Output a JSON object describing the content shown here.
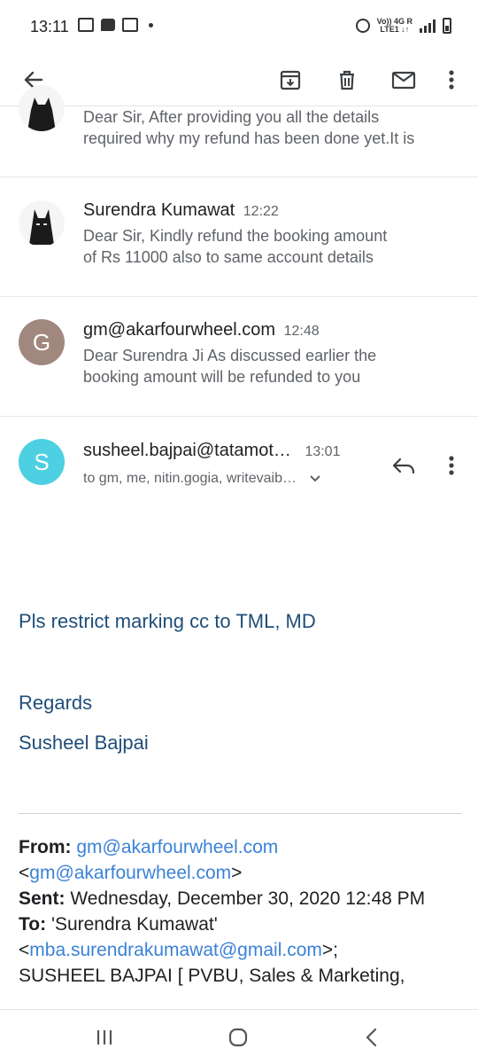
{
  "status_bar": {
    "time": "13:11",
    "network_top": "Vo)) 4G R",
    "network_bottom": "LTE1 ↓↑"
  },
  "toolbar": {
    "icons": [
      "back-arrow-icon",
      "archive-icon",
      "delete-icon",
      "mark-unread-icon",
      "more-vert-icon"
    ]
  },
  "thread": {
    "messages": [
      {
        "sender": "",
        "time": "",
        "snippet_line1": "Dear Sir, After providing you all the details",
        "snippet_line2": "required why my refund has been done yet.It is"
      },
      {
        "sender": "Surendra Kumawat",
        "time": "12:22",
        "snippet_line1": "Dear Sir, Kindly refund the booking amount",
        "snippet_line2": "of Rs 11000 also to same account details"
      },
      {
        "sender": "gm@akarfourwheel.com",
        "time": "12:48",
        "avatar_letter": "G",
        "avatar_color": "#a1887f",
        "snippet_line1": "Dear Surendra Ji As discussed earlier the",
        "snippet_line2": "booking amount will be refunded to you"
      }
    ],
    "expanded": {
      "sender": "susheel.bajpai@tatamot…",
      "time": "13:01",
      "avatar_letter": "S",
      "avatar_color": "#4dd0e1",
      "recipients": "to gm, me, nitin.gogia, writevaib…"
    }
  },
  "body": {
    "line1": "Pls restrict marking cc to TML, MD",
    "regards": "Regards",
    "signature": "Susheel Bajpai"
  },
  "quoted": {
    "from_label": "From:",
    "from_email": "gm@akarfourwheel.com",
    "from_email_bracket": "gm@akarfourwheel.com",
    "sent_label": "Sent:",
    "sent_value": "Wednesday, December 30, 2020 12:48 PM",
    "to_label": "To:",
    "to_name": "'Surendra Kumawat'",
    "to_email": "mba.surendrakumawat@gmail.com",
    "next_line": "SUSHEEL BAJPAI [ PVBU, Sales & Marketing,"
  },
  "colors": {
    "link": "#3b82d6",
    "body_text": "#1f4e79"
  }
}
